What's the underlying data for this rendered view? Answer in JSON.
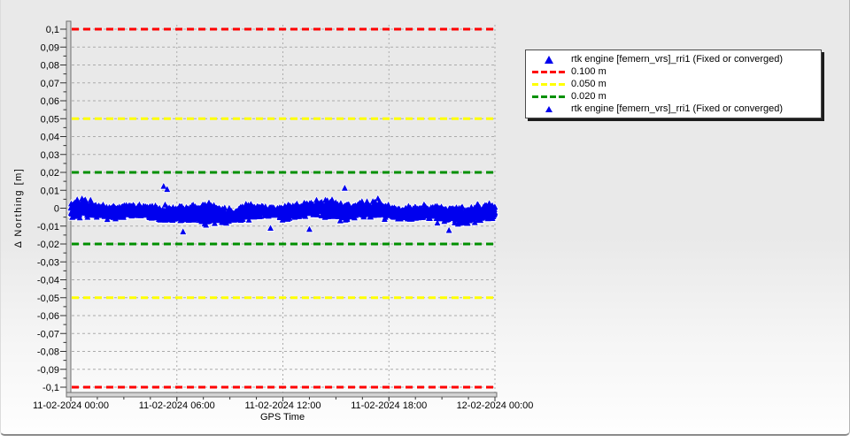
{
  "window": {
    "bg_top": "#e9e9e9",
    "bg_bottom": "#fefefe",
    "border_color": "#8b8b8b"
  },
  "chart_data": {
    "type": "scatter",
    "title": "",
    "xlabel": "GPS Time",
    "ylabel": "Δ Northing [m]",
    "x_tick_labels": [
      "11-02-2024 00:00",
      "11-02-2024 06:00",
      "11-02-2024 12:00",
      "11-02-2024 18:00",
      "12-02-2024 00:00"
    ],
    "x_tick_hours": [
      0,
      6,
      12,
      18,
      24
    ],
    "x_minor_tick_step_hours": 1.5,
    "xlim_hours": [
      0,
      24
    ],
    "y_tick_labels": [
      "0,1",
      "0,09",
      "0,08",
      "0,07",
      "0,06",
      "0,05",
      "0,04",
      "0,03",
      "0,02",
      "0,01",
      "0",
      "-0,01",
      "-0,02",
      "-0,03",
      "-0,04",
      "-0,05",
      "-0,06",
      "-0,07",
      "-0,08",
      "-0,09",
      "-0,1"
    ],
    "y_tick_values": [
      0.1,
      0.09,
      0.08,
      0.07,
      0.06,
      0.05,
      0.04,
      0.03,
      0.02,
      0.01,
      0,
      -0.01,
      -0.02,
      -0.03,
      -0.04,
      -0.05,
      -0.06,
      -0.07,
      -0.08,
      -0.09,
      -0.1
    ],
    "y_minor_step": 0.005,
    "ylim": [
      -0.1045,
      0.1025
    ],
    "grid": "dashed",
    "grid_color": "#ababab",
    "axis_bar_fill": "#d4d4d4",
    "axis_bar_edge": "#6e6e6e",
    "thresholds": [
      {
        "label": "0.100 m",
        "value": 0.1,
        "color": "#ff0000"
      },
      {
        "label": "0.050 m",
        "value": 0.05,
        "color": "#ffff00"
      },
      {
        "label": "0.020 m",
        "value": 0.02,
        "color": "#009000"
      }
    ],
    "series": [
      {
        "name": "rtk engine [femern_vrs]_rri1 (Fixed or converged)",
        "marker": "triangle",
        "color": "#0000ee",
        "role": "halo-background",
        "halo_color": "#ffffff",
        "marker_px": 5.2
      },
      {
        "name": "rtk engine [femern_vrs]_rri1 (Fixed or converged)",
        "marker": "triangle",
        "color": "#0000ee",
        "role": "points",
        "marker_px": 3.8
      }
    ],
    "noise_band": {
      "seed": 1337,
      "n_points": 3200,
      "center_m": -0.002,
      "typical_half_width_m": 0.006,
      "band_min_m": -0.0105,
      "band_max_m": 0.008,
      "clamp_min_m": -0.0135,
      "clamp_max_m": 0.0125
    },
    "outliers": [
      {
        "t_hours": 5.25,
        "y_m": 0.0122
      },
      {
        "t_hours": 5.45,
        "y_m": 0.0105
      },
      {
        "t_hours": 15.5,
        "y_m": 0.0112
      },
      {
        "t_hours": 6.35,
        "y_m": -0.0132
      },
      {
        "t_hours": 11.3,
        "y_m": -0.0112
      },
      {
        "t_hours": 13.5,
        "y_m": -0.0118
      },
      {
        "t_hours": 21.4,
        "y_m": -0.0124
      }
    ],
    "legend": {
      "entries": [
        {
          "symbol": "triangle",
          "size": "large",
          "color": "#0000ee",
          "label": "rtk engine [femern_vrs]_rri1 (Fixed or converged)"
        },
        {
          "symbol": "dashes",
          "color": "#ff0000",
          "label": "0.100 m"
        },
        {
          "symbol": "dashes",
          "color": "#ffff00",
          "label": "0.050 m"
        },
        {
          "symbol": "dashes",
          "color": "#009000",
          "label": "0.020 m"
        },
        {
          "symbol": "triangle",
          "size": "small",
          "color": "#0000ee",
          "label": "rtk engine [femern_vrs]_rri1 (Fixed or converged)"
        }
      ]
    }
  }
}
